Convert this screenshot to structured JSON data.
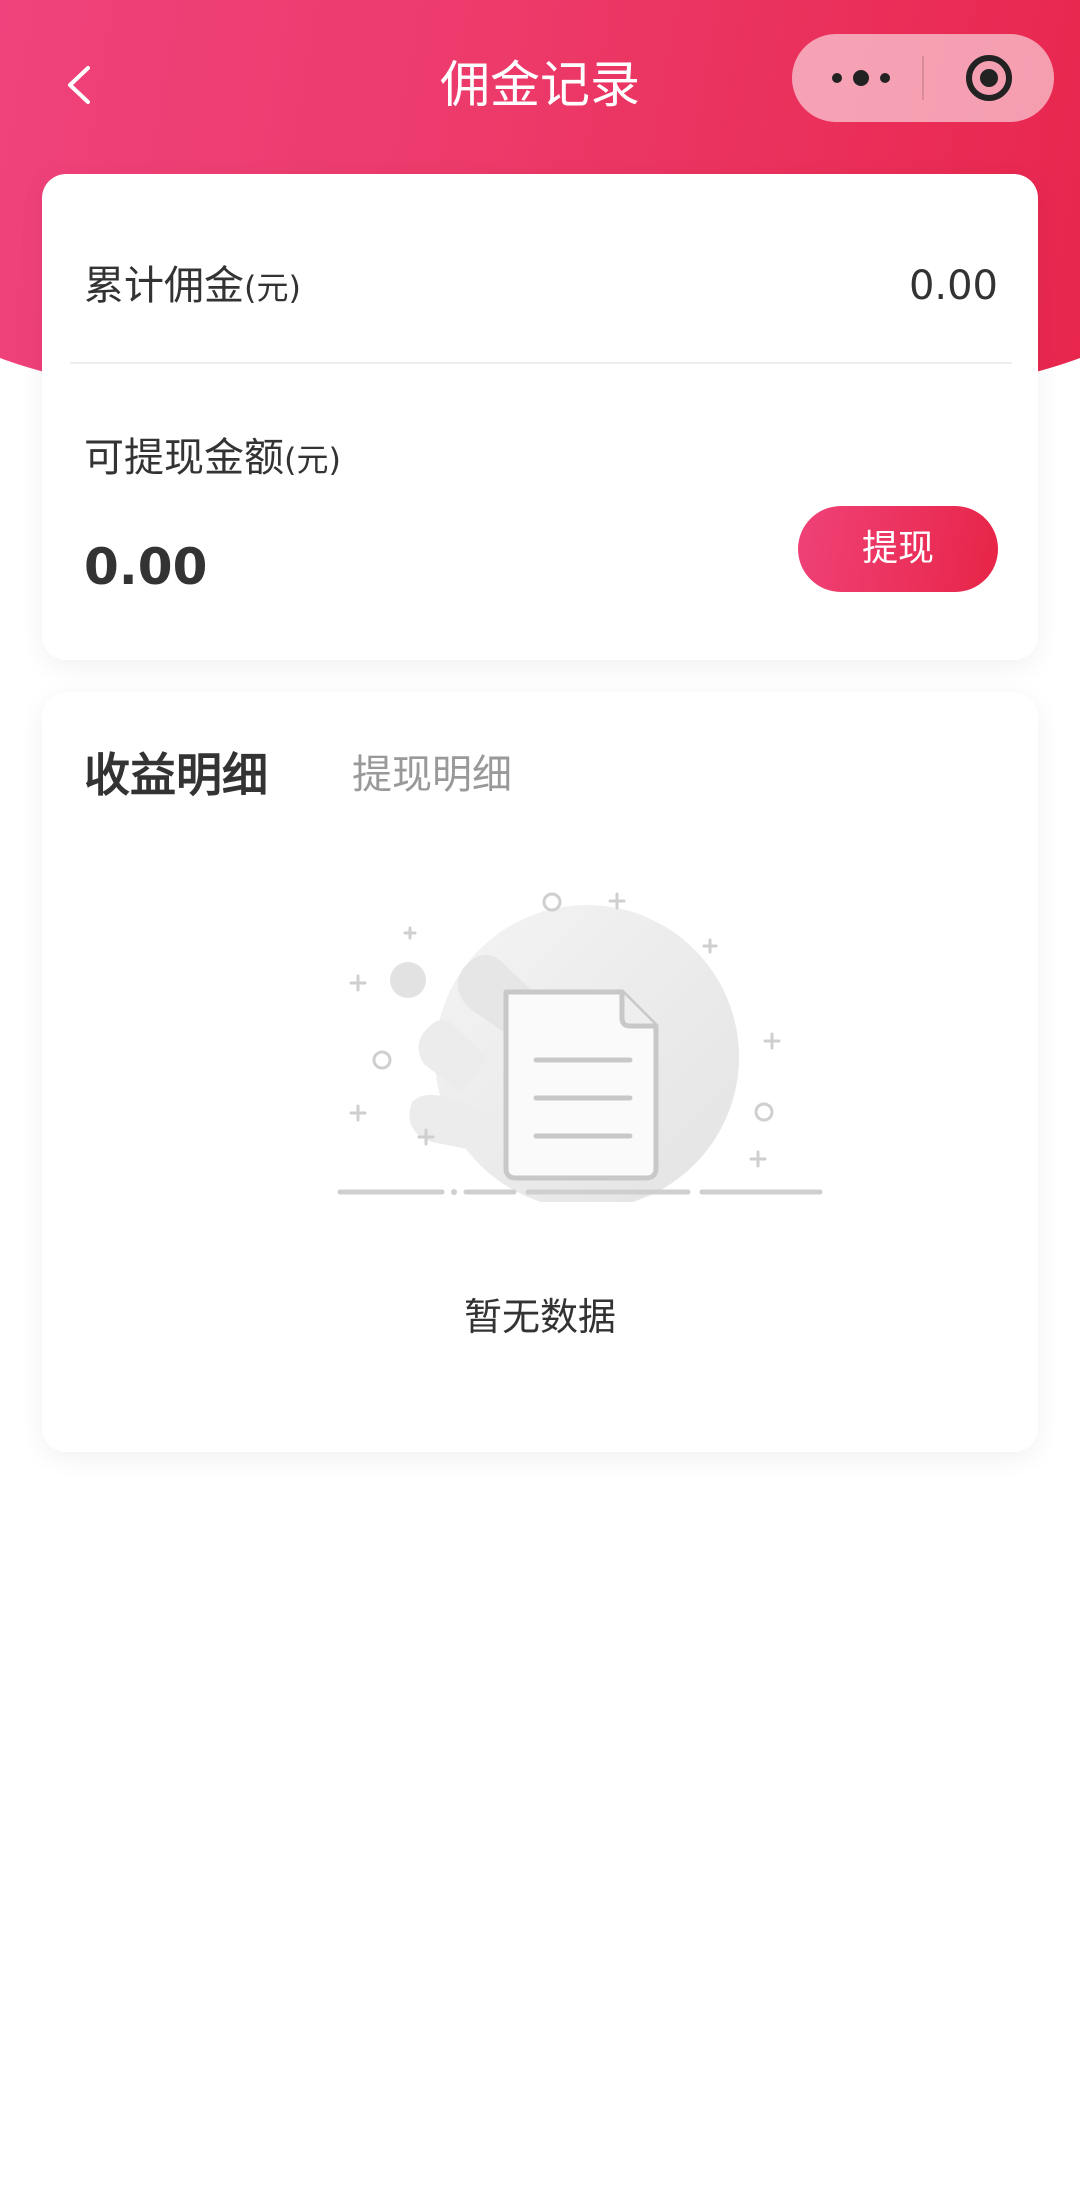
{
  "nav": {
    "title": "佣金记录"
  },
  "summary": {
    "total_label": "累计佣金",
    "total_unit": "(元)",
    "total_value": "0.00",
    "available_label": "可提现金额",
    "available_unit": "(元)",
    "available_value": "0.00",
    "withdraw_button": "提现"
  },
  "details": {
    "tabs": [
      {
        "label": "收益明细",
        "active": true
      },
      {
        "label": "提现明细",
        "active": false
      }
    ],
    "empty_text": "暂无数据"
  },
  "icons": {
    "back": "chevron-left-icon",
    "more": "more-dots-icon",
    "close": "target-circle-icon",
    "empty": "empty-document-icon"
  },
  "colors": {
    "brand_start": "#f0437e",
    "brand_end": "#e8244a",
    "text_primary": "#333333",
    "text_secondary": "#999999"
  }
}
